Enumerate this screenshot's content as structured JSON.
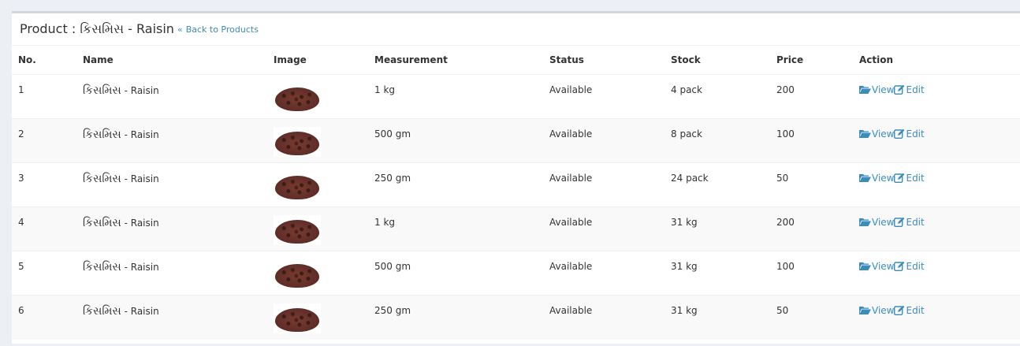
{
  "header": {
    "title": "Product : કિસમિસ - Raisin",
    "back_link": "Back to Products",
    "back_chevron": "«"
  },
  "table": {
    "columns": [
      "No.",
      "Name",
      "Image",
      "Measurement",
      "Status",
      "Stock",
      "Price",
      "Action"
    ],
    "action_labels": {
      "view": "View",
      "edit": "Edit"
    },
    "rows": [
      {
        "no": "1",
        "name_gu": "કિસમિસ",
        "name_en": " - Raisin",
        "measurement": "1 kg",
        "status": "Available",
        "stock": "4 pack",
        "price": "200"
      },
      {
        "no": "2",
        "name_gu": "કિસમિસ",
        "name_en": " - Raisin",
        "measurement": "500 gm",
        "status": "Available",
        "stock": "8 pack",
        "price": "100"
      },
      {
        "no": "3",
        "name_gu": "કિસમિસ",
        "name_en": " - Raisin",
        "measurement": "250 gm",
        "status": "Available",
        "stock": "24 pack",
        "price": "50"
      },
      {
        "no": "4",
        "name_gu": "કિસમિસ",
        "name_en": " - Raisin",
        "measurement": "1 kg",
        "status": "Available",
        "stock": "31 kg",
        "price": "200"
      },
      {
        "no": "5",
        "name_gu": "કિસમિસ",
        "name_en": " - Raisin",
        "measurement": "500 gm",
        "status": "Available",
        "stock": "31 kg",
        "price": "100"
      },
      {
        "no": "6",
        "name_gu": "કિસમિસ",
        "name_en": " - Raisin",
        "measurement": "250 gm",
        "status": "Available",
        "stock": "31 kg",
        "price": "50"
      }
    ]
  },
  "icons": {
    "view": "folder-open-icon",
    "edit": "edit-icon"
  },
  "colors": {
    "link": "#3c8dbc",
    "stripe": "#f9f9f9"
  }
}
